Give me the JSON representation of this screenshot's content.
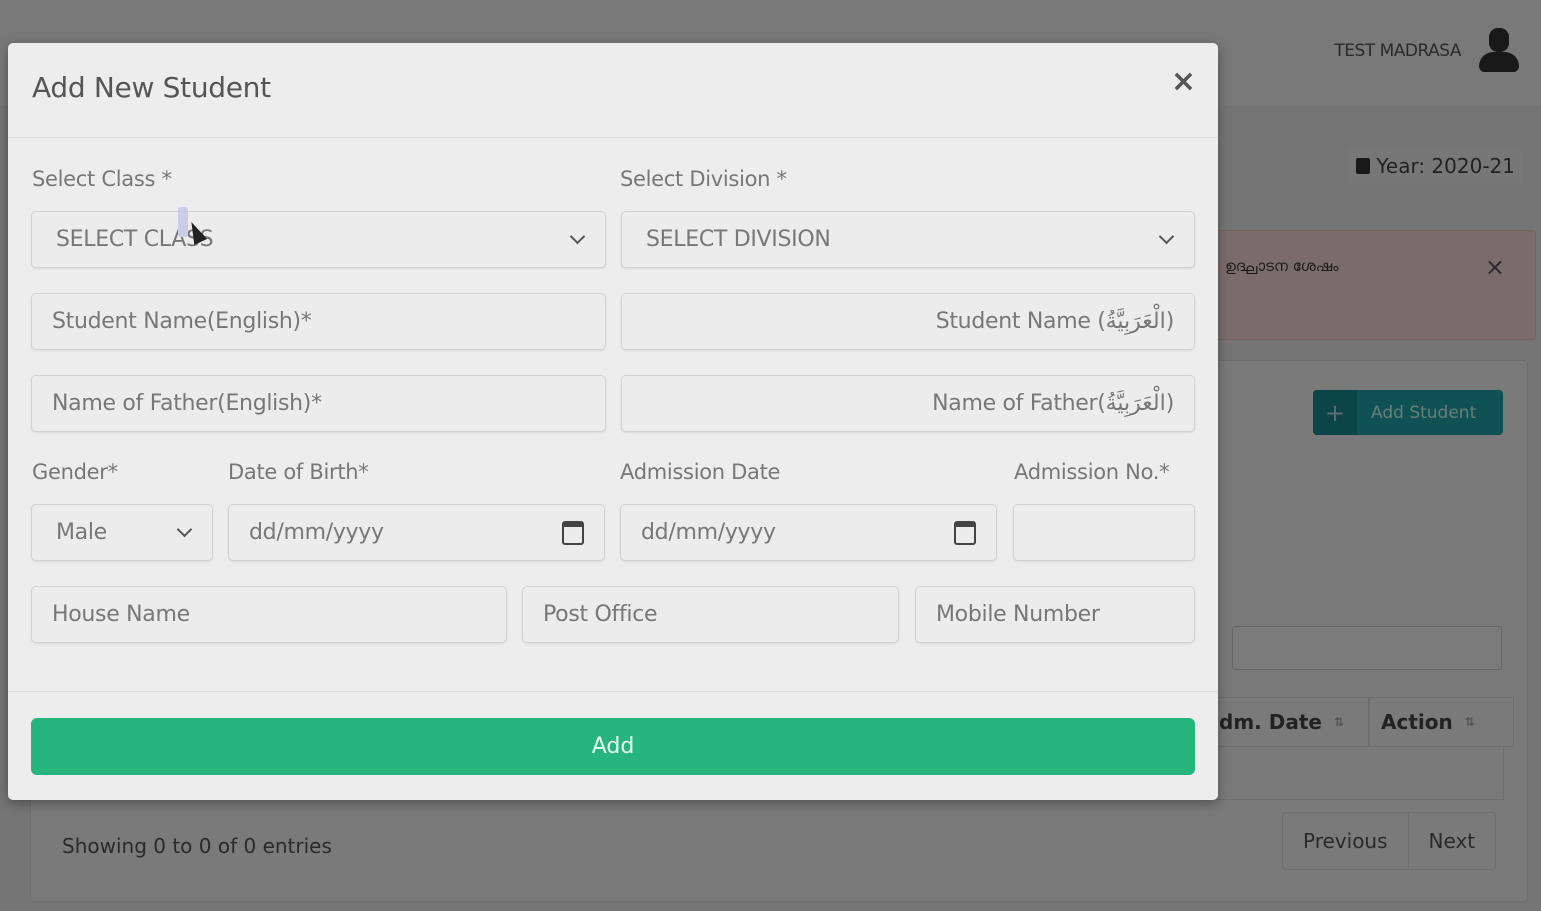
{
  "background": {
    "user_name": "TEST MADRASA",
    "year_label": "Year: 2020-21",
    "alert_text": "ഉദ്ഘാടന ശേഷം",
    "alert_close": "×",
    "add_student_label": "Add Student",
    "add_student_icon": "+",
    "table_headers": [
      {
        "label": "dm. Date",
        "sort_icon": "⇅"
      },
      {
        "label": "Action",
        "sort_icon": "⇅"
      }
    ],
    "entries_info": "Showing 0 to 0 of 0 entries",
    "pagination": {
      "previous": "Previous",
      "next": "Next"
    }
  },
  "modal": {
    "title": "Add New Student",
    "close_label": "×",
    "fields": {
      "class": {
        "label": "Select Class *",
        "value": "SELECT CLASS"
      },
      "division": {
        "label": "Select Division *",
        "value": "SELECT DIVISION"
      },
      "student_name_en": {
        "placeholder": "Student Name(English)*"
      },
      "student_name_ar": {
        "placeholder": "Student Name (ﺍﻟْﻌَﺮَﺑِﻴَّﺔُ)"
      },
      "father_name_en": {
        "placeholder": "Name of Father(English)*"
      },
      "father_name_ar": {
        "placeholder": "Name of Father(ﺍﻟْﻌَﺮَﺑِﻴَّﺔُ)"
      },
      "gender": {
        "label": "Gender*",
        "value": "Male"
      },
      "dob": {
        "label": "Date of Birth*",
        "placeholder": "dd/mm/yyyy"
      },
      "admission_date": {
        "label": "Admission Date",
        "placeholder": "dd/mm/yyyy"
      },
      "admission_no": {
        "label": "Admission No.*",
        "value": ""
      },
      "house_name": {
        "placeholder": "House Name"
      },
      "post_office": {
        "placeholder": "Post Office"
      },
      "mobile": {
        "placeholder": "Mobile Number"
      }
    },
    "submit_label": "Add"
  },
  "colors": {
    "submit_green": "#26b57c",
    "add_student_teal": "#1fa3a8",
    "alert_bg": "#f7d9d9"
  }
}
